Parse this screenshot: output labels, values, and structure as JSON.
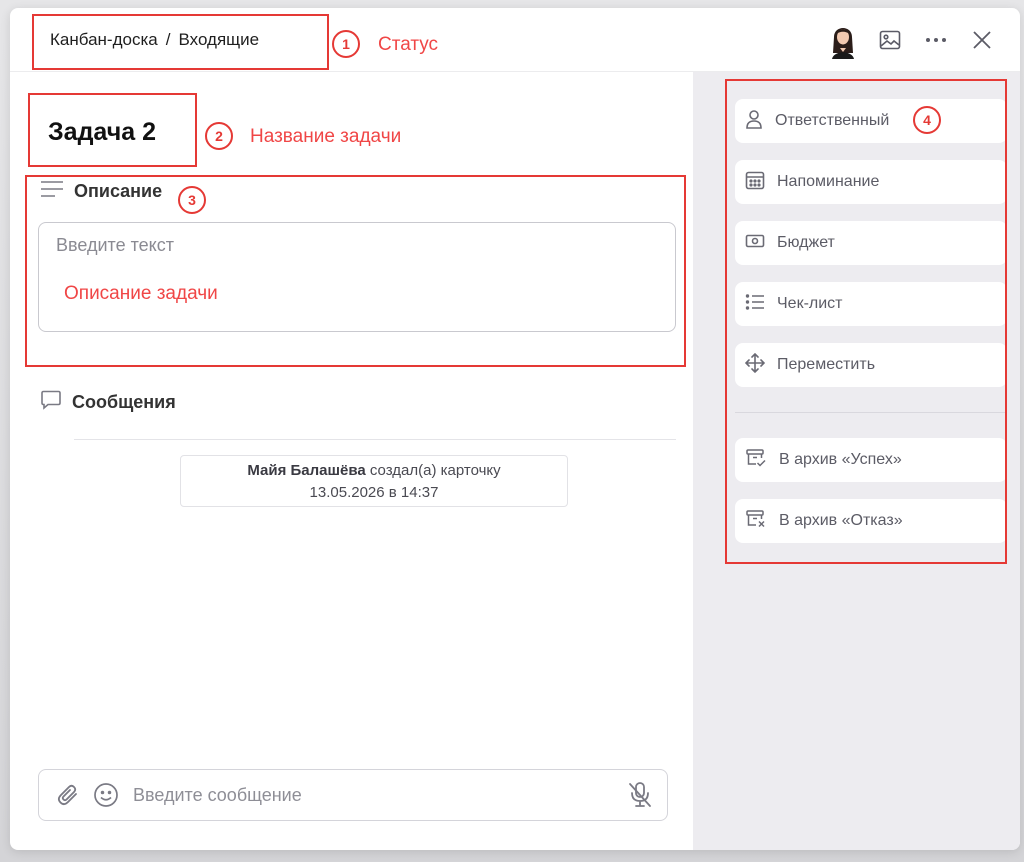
{
  "header": {
    "breadcrumb": [
      "Канбан-доска",
      "Входящие"
    ],
    "breadcrumb_separator": "/",
    "icons": [
      "image-icon",
      "more-icon",
      "close-icon"
    ]
  },
  "task": {
    "title": "Задача 2"
  },
  "description": {
    "heading": "Описание",
    "placeholder": "Введите текст"
  },
  "messages": {
    "heading": "Сообщения",
    "event": {
      "author": "Майя Балашёва",
      "action": "создал(а) карточку",
      "timestamp": "13.05.2026 в 14:37"
    }
  },
  "composer": {
    "placeholder": "Введите сообщение"
  },
  "sidebar": {
    "items": [
      {
        "label": "Ответственный",
        "icon": "person-icon"
      },
      {
        "label": "Напоминание",
        "icon": "calendar-icon"
      },
      {
        "label": "Бюджет",
        "icon": "money-icon"
      },
      {
        "label": "Чек-лист",
        "icon": "checklist-icon"
      },
      {
        "label": "Переместить",
        "icon": "move-icon"
      }
    ],
    "archive_items": [
      {
        "label": "В архив «Успех»",
        "icon": "archive-success-icon"
      },
      {
        "label": "В архив «Отказ»",
        "icon": "archive-fail-icon"
      }
    ]
  },
  "annotations": {
    "n1": "1",
    "label1": "Статус",
    "n2": "2",
    "label2": "Название задачи",
    "n3": "3",
    "label3": "Описание задачи",
    "n4": "4"
  },
  "colors": {
    "annotation": "#e53935",
    "sidebar_bg": "#edecf0"
  }
}
